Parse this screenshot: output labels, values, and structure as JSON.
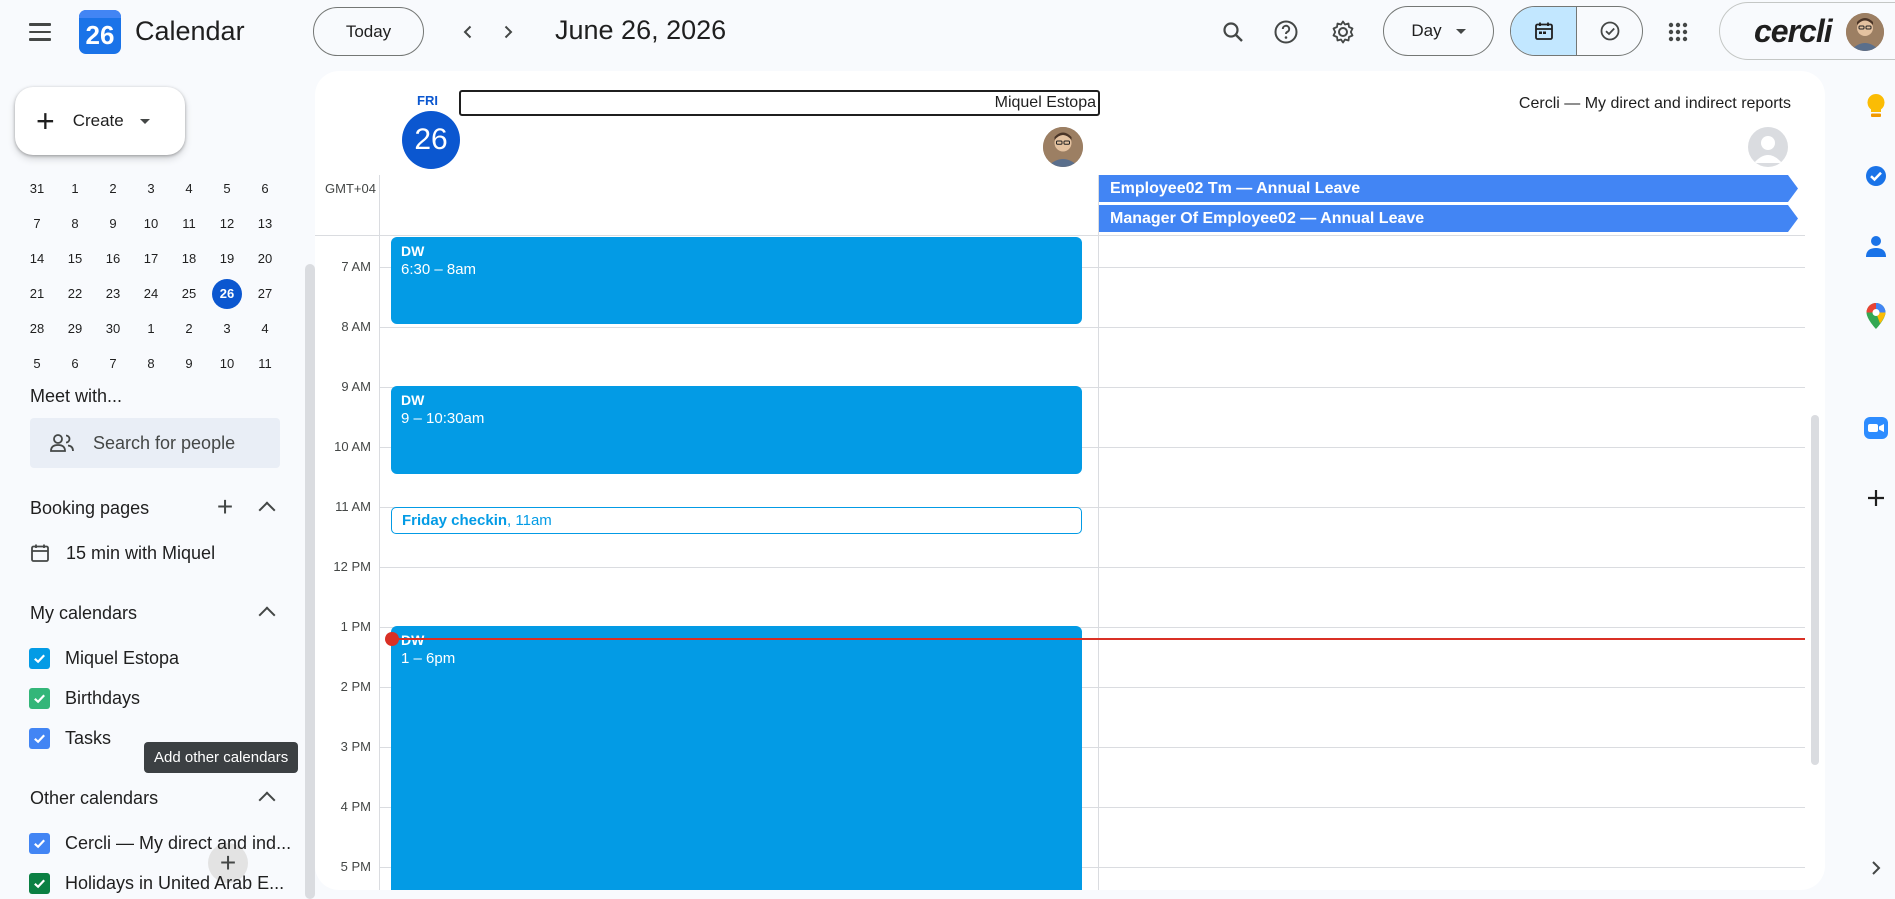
{
  "header": {
    "app_title": "Calendar",
    "logo_date": "26",
    "today_label": "Today",
    "prev_icon": "chevron-left-icon",
    "next_icon": "chevron-right-icon",
    "date_title": "June 26, 2026",
    "view_label": "Day",
    "account_brand": "cercli"
  },
  "sidebar": {
    "create_label": "Create",
    "mini_calendar": [
      [
        "31",
        "1",
        "2",
        "3",
        "4",
        "5",
        "6"
      ],
      [
        "7",
        "8",
        "9",
        "10",
        "11",
        "12",
        "13"
      ],
      [
        "14",
        "15",
        "16",
        "17",
        "18",
        "19",
        "20"
      ],
      [
        "21",
        "22",
        "23",
        "24",
        "25",
        "26",
        "27"
      ],
      [
        "28",
        "29",
        "30",
        "1",
        "2",
        "3",
        "4"
      ],
      [
        "5",
        "6",
        "7",
        "8",
        "9",
        "10",
        "11"
      ]
    ],
    "meet_with_title": "Meet with...",
    "search_people_placeholder": "Search for people",
    "booking_title": "Booking pages",
    "booking_item": "15 min with Miquel",
    "my_calendars_title": "My calendars",
    "my_calendars": [
      {
        "label": "Miquel Estopa",
        "color": "#039be5"
      },
      {
        "label": "Birthdays",
        "color": "#33b679"
      },
      {
        "label": "Tasks",
        "color": "#4285f4"
      }
    ],
    "tooltip": "Add other calendars",
    "other_calendars_title": "Other calendars",
    "other_calendars": [
      {
        "label": "Cercli — My direct and ind...",
        "color": "#4285f4"
      },
      {
        "label": "Holidays in United Arab E...",
        "color": "#0b8043"
      }
    ]
  },
  "main": {
    "day_of_week": "FRI",
    "day_number": "26",
    "column1_name": "Miquel Estopa",
    "column2_name": "Cercli — My direct and indirect reports",
    "timezone": "GMT+04",
    "all_day_events": [
      "Employee02 Tm — Annual Leave",
      "Manager Of Employee02 — Annual Leave"
    ],
    "hours": [
      "7 AM",
      "8 AM",
      "9 AM",
      "10 AM",
      "11 AM",
      "12 PM",
      "1 PM",
      "2 PM",
      "3 PM",
      "4 PM",
      "5 PM"
    ],
    "events": [
      {
        "title": "DW",
        "time": "6:30 – 8am"
      },
      {
        "title": "DW",
        "time": "9 – 10:30am"
      },
      {
        "title": "DW",
        "time": "1 – 6pm"
      }
    ],
    "checkin": {
      "title": "Friday checkin",
      "time": ", 11am"
    }
  },
  "colors": {
    "accent": "#0b57d0",
    "event": "#039be5",
    "allday": "#4285f4",
    "now": "#d93025"
  }
}
